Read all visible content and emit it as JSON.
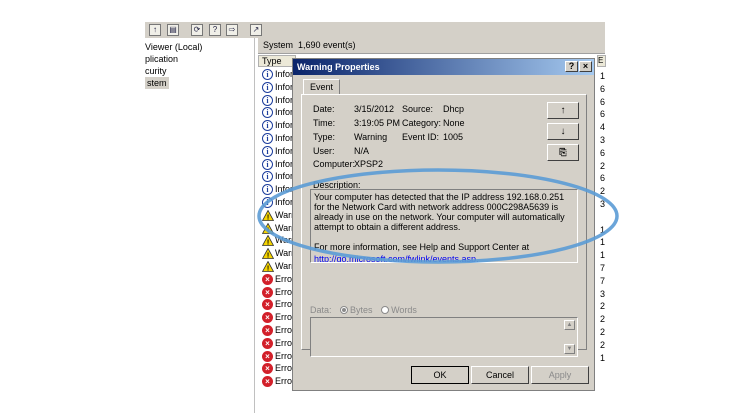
{
  "toolbar": {
    "icons": [
      "up-icon",
      "properties-icon",
      "refresh-icon",
      "export-icon",
      "help-icon"
    ]
  },
  "tree": {
    "items": [
      {
        "label": "Viewer (Local)"
      },
      {
        "label": "plication"
      },
      {
        "label": "curity"
      },
      {
        "label": "stem"
      }
    ]
  },
  "list": {
    "log_name": "System",
    "count": "1,690 event(s)",
    "type_header": "Type",
    "right_header": "E",
    "rows": [
      {
        "kind": "info",
        "label": "Infor"
      },
      {
        "kind": "info",
        "label": "Infor"
      },
      {
        "kind": "info",
        "label": "Infor"
      },
      {
        "kind": "info",
        "label": "Infor"
      },
      {
        "kind": "info",
        "label": "Infor"
      },
      {
        "kind": "info",
        "label": "Infor"
      },
      {
        "kind": "info",
        "label": "Infor"
      },
      {
        "kind": "info",
        "label": "Infor"
      },
      {
        "kind": "info",
        "label": "Infor"
      },
      {
        "kind": "info",
        "label": "Infor"
      },
      {
        "kind": "info",
        "label": "Infor"
      },
      {
        "kind": "warn",
        "label": "Warn"
      },
      {
        "kind": "warn",
        "label": "Warn"
      },
      {
        "kind": "warn",
        "label": "Warn"
      },
      {
        "kind": "warn",
        "label": "Warn"
      },
      {
        "kind": "warn",
        "label": "Warn"
      },
      {
        "kind": "error",
        "label": "Error"
      },
      {
        "kind": "error",
        "label": "Error"
      },
      {
        "kind": "error",
        "label": "Error"
      },
      {
        "kind": "error",
        "label": "Error"
      },
      {
        "kind": "error",
        "label": "Error"
      },
      {
        "kind": "error",
        "label": "Error"
      },
      {
        "kind": "error",
        "label": "Error"
      },
      {
        "kind": "error",
        "label": "Error"
      },
      {
        "kind": "error",
        "label": "Error"
      }
    ],
    "right_digits": [
      "1",
      "6",
      "6",
      "6",
      "4",
      "3",
      "6",
      "2",
      "6",
      "2",
      "3",
      "",
      "1",
      "1",
      "1",
      "7",
      "7",
      "3",
      "2",
      "2",
      "2",
      "2",
      "1"
    ]
  },
  "dialog": {
    "title": "Warning Properties",
    "help_btn": "?",
    "close_btn": "×",
    "tab": "Event",
    "fields": {
      "date_label": "Date:",
      "date": "3/15/2012",
      "source_label": "Source:",
      "source": "Dhcp",
      "time_label": "Time:",
      "time": "3:19:05 PM",
      "category_label": "Category:",
      "category": "None",
      "type_label": "Type:",
      "type": "Warning",
      "event_id_label": "Event ID:",
      "event_id": "1005",
      "user_label": "User:",
      "user": "N/A",
      "computer_label": "Computer:",
      "computer": "XPSP2"
    },
    "description_label": "Description:",
    "description": "Your computer has detected that the IP address 192.168.0.251 for the Network Card with network address 000C298A5639 is already in use on the network. Your computer will automatically attempt to obtain a different address.",
    "more_info": "For more information, see Help and Support Center at",
    "link": "http://go.microsoft.com/fwlink/events.asp.",
    "data_label": "Data:",
    "bytes_label": "Bytes",
    "words_label": "Words",
    "ok": "OK",
    "cancel": "Cancel",
    "apply": "Apply"
  },
  "annotation_color": "#5b9bd5"
}
